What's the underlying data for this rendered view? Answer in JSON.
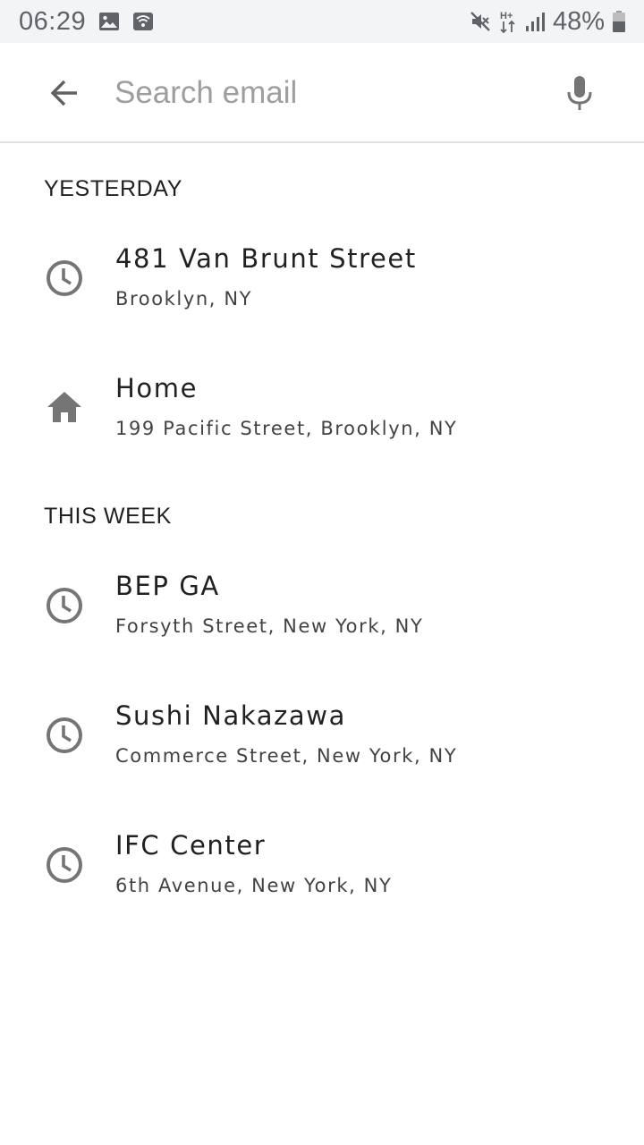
{
  "status_bar": {
    "time": "06:29",
    "battery_text": "48%",
    "left_icons": [
      "image-icon",
      "wifi-calling-icon"
    ],
    "right_icons": [
      "mute-icon",
      "hplus-data-icon",
      "signal-icon",
      "battery-icon"
    ]
  },
  "search": {
    "placeholder": "Search email",
    "value": ""
  },
  "sections": [
    {
      "header": "YESTERDAY",
      "items": [
        {
          "icon": "clock-icon",
          "title": "481 Van Brunt Street",
          "subtitle": "Brooklyn, NY"
        },
        {
          "icon": "home-icon",
          "title": "Home",
          "subtitle": "199 Pacific Street, Brooklyn, NY"
        }
      ]
    },
    {
      "header": "THIS WEEK",
      "items": [
        {
          "icon": "clock-icon",
          "title": "BEP GA",
          "subtitle": "Forsyth Street, New York, NY"
        },
        {
          "icon": "clock-icon",
          "title": "Sushi Nakazawa",
          "subtitle": "Commerce Street, New York, NY"
        },
        {
          "icon": "clock-icon",
          "title": "IFC Center",
          "subtitle": "6th Avenue, New York, NY"
        }
      ]
    }
  ],
  "colors": {
    "icon": "#757575",
    "status_bar_bg": "#f3f4f6",
    "placeholder": "#9e9e9e",
    "divider": "#e0e0e0"
  }
}
